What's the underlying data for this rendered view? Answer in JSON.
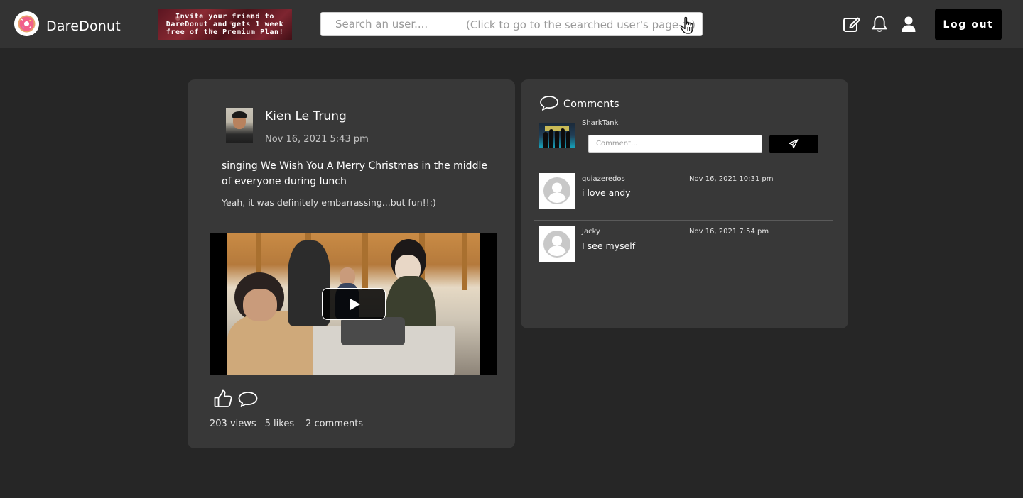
{
  "app": {
    "name": "DareDonut",
    "promo_text": "Invite your friend to\nDareDonut and gets 1 week\nfree of the Premium Plan!"
  },
  "search": {
    "placeholder": "Search an user....",
    "hint": "(Click  to go to the searched user's page->)"
  },
  "nav": {
    "icons": [
      "edit-icon",
      "bell-icon",
      "user-icon"
    ],
    "logout_label": "Log out"
  },
  "post": {
    "author": "Kien Le Trung",
    "date": "Nov 16, 2021 5:43 pm",
    "title": "singing We Wish You A Merry Christmas in the middle of everyone during lunch",
    "body": "Yeah, it was definitely embarrassing...but fun!!:)",
    "views": "203 views",
    "likes": "5 likes",
    "comments_count": "2 comments"
  },
  "comments": {
    "title": "Comments",
    "current_user": "SharkTank",
    "input_placeholder": "Comment...",
    "items": [
      {
        "user": "guiazeredos",
        "date": "Nov 16, 2021 10:31 pm",
        "text": "i love andy"
      },
      {
        "user": "Jacky",
        "date": "Nov 16, 2021 7:54 pm",
        "text": "I see myself"
      }
    ]
  },
  "colors": {
    "page_bg": "#262626",
    "navbar_bg": "#333333",
    "card_bg": "#383838",
    "button_bg": "#000000",
    "text": "#ffffff"
  }
}
